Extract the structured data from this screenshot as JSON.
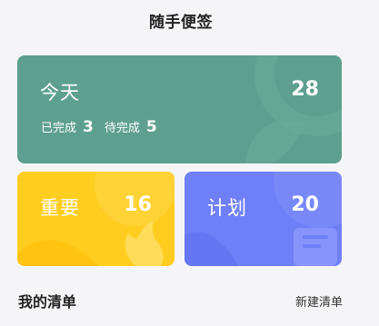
{
  "header": {
    "title": "随手便签"
  },
  "today": {
    "label": "今天",
    "count": "28",
    "done_label": "已完成",
    "done_count": "3",
    "pending_label": "待完成",
    "pending_count": "5"
  },
  "important": {
    "label": "重要",
    "count": "16"
  },
  "plan": {
    "label": "计划",
    "count": "20"
  },
  "lists": {
    "title": "我的清单",
    "new_label": "新建清单"
  },
  "colors": {
    "today": "#5ea08f",
    "important": "#ffcd1f",
    "plan": "#6f7ff8",
    "background": "#f5f5f7"
  }
}
